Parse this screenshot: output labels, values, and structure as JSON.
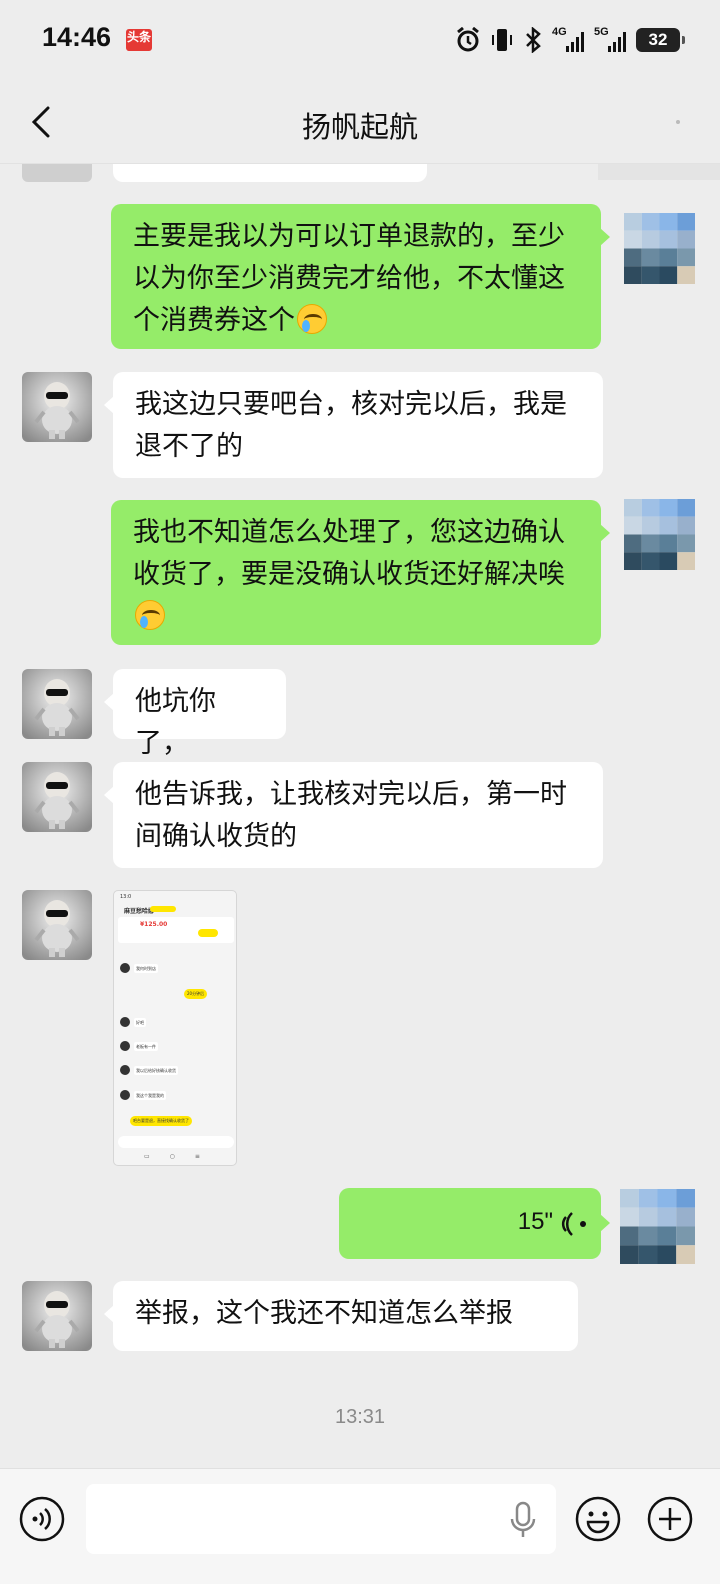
{
  "status_bar": {
    "time": "14:46",
    "app_badge": "头条",
    "network_1": "4G",
    "network_2": "5G",
    "battery": "32"
  },
  "header": {
    "title": "扬帆起航"
  },
  "messages": [
    {
      "id": 1,
      "side": "out",
      "text": "主要是我以为可以订单退款的，至少以为你至少消费完才给他，不太懂这个消费券这个",
      "emoji": "face-with-tears-of-joy"
    },
    {
      "id": 2,
      "side": "in",
      "text": "我这边只要吧台，核对完以后，我是退不了的"
    },
    {
      "id": 3,
      "side": "out",
      "text": "我也不知道怎么处理了，您这边确认收货了，要是没确认收货还好解决唉",
      "emoji": "face-with-tears-of-joy"
    },
    {
      "id": 4,
      "side": "in",
      "text": "他坑你了，"
    },
    {
      "id": 5,
      "side": "in",
      "text": "他告诉我，让我核对完以后，第一时间确认收货的"
    },
    {
      "id": 6,
      "side": "in",
      "type": "image",
      "thumb": {
        "time": "13:0",
        "title": "麻豆愁哈娜",
        "price": "¥125.00",
        "msgs": [
          "我何时到店",
          "20分钟后",
          "好吧",
          "老板有一件",
          "我以后给好核确认收货",
          "我这个我是我的",
          "吧台要是退，直接找确认收货了"
        ]
      }
    },
    {
      "id": 7,
      "side": "out",
      "type": "voice",
      "duration": "15\""
    },
    {
      "id": 8,
      "side": "in",
      "text": "举报，这个我还不知道怎么举报"
    }
  ],
  "timestamp": "13:31",
  "input_bar": {
    "placeholder": ""
  },
  "colors": {
    "out_bubble": "#95ec69",
    "in_bubble": "#ffffff",
    "background": "#ededed"
  }
}
